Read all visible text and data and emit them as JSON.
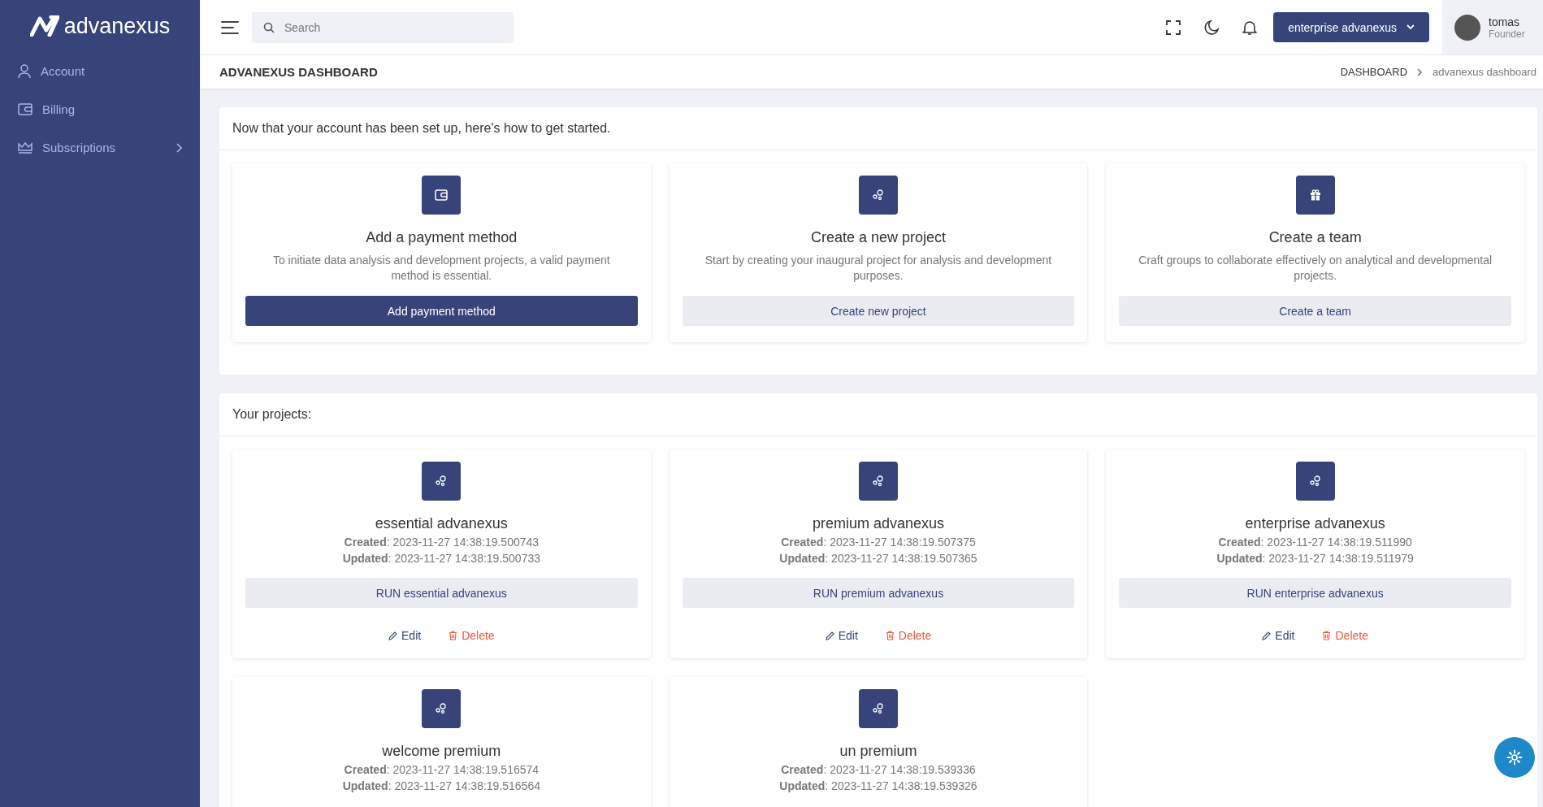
{
  "sidebar": {
    "logo": "advanexus",
    "items": [
      {
        "label": "Account",
        "kind": "link"
      },
      {
        "label": "Billing",
        "kind": "link"
      },
      {
        "label": "Subscriptions",
        "kind": "group"
      }
    ]
  },
  "header": {
    "search": {
      "placeholder": "Search"
    },
    "workspace_button": "enterprise advanexus",
    "user": {
      "name": "tomas",
      "role": "Founder"
    }
  },
  "page_title": "ADVANEXUS DASHBOARD",
  "breadcrumb": [
    {
      "label": "DASHBOARD",
      "selected": false
    },
    {
      "label": "advanexus dashboard",
      "selected": true
    }
  ],
  "getting_started": {
    "title": "Now that your account has been set up, here's how to get started.",
    "cards": [
      {
        "title": "Add a payment method",
        "text": "To initiate data analysis and development projects, a valid payment method is essential.",
        "button": "Add payment method",
        "kind": "primary"
      },
      {
        "title": "Create a new project",
        "text": "Start by creating your inaugural project for analysis and development purposes.",
        "button": "Create new project",
        "kind": "secondary"
      },
      {
        "title": "Create a team",
        "text": "Craft groups to collaborate effectively on analytical and developmental projects.",
        "button": "Create a team",
        "kind": "secondary"
      }
    ]
  },
  "projects": {
    "title": "Your projects:",
    "items": [
      {
        "name": "essential advanexus",
        "created": "**Created**: 2023-11-27 14:38:19.500743",
        "updated": "**Updated**: 2023-11-27 14:38:19.500733",
        "run": "RUN essential advanexus",
        "edit": "Edit",
        "delete": "Delete"
      },
      {
        "name": "premium advanexus",
        "created": "**Created**: 2023-11-27 14:38:19.507375",
        "updated": "**Updated**: 2023-11-27 14:38:19.507365",
        "run": "RUN premium advanexus",
        "edit": "Edit",
        "delete": "Delete"
      },
      {
        "name": "enterprise advanexus",
        "created": "**Created**: 2023-11-27 14:38:19.511990",
        "updated": "**Updated**: 2023-11-27 14:38:19.511979",
        "run": "RUN enterprise advanexus",
        "edit": "Edit",
        "delete": "Delete"
      },
      {
        "name": "welcome premium",
        "created": "**Created**: 2023-11-27 14:38:19.516574",
        "updated": "**Updated**: 2023-11-27 14:38:19.516564"
      },
      {
        "name": "un premium",
        "created": "**Created**: 2023-11-27 14:38:19.539336",
        "updated": "**Updated**: 2023-11-27 14:38:19.539326"
      }
    ]
  }
}
